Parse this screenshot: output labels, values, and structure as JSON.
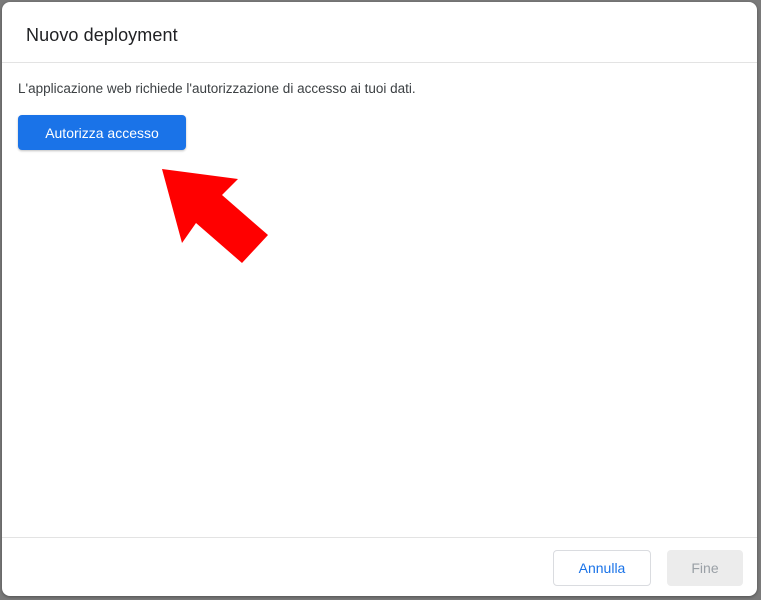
{
  "dialog": {
    "title": "Nuovo deployment",
    "message": "L'applicazione web richiede l'autorizzazione di accesso ai tuoi dati.",
    "authorize_label": "Autorizza accesso",
    "cancel_label": "Annulla",
    "done_label": "Fine",
    "done_disabled": true
  },
  "annotation": {
    "icon": "red-arrow-icon",
    "color": "#ff0000"
  },
  "colors": {
    "primary": "#1a73e8",
    "disabled_bg": "#ececec",
    "disabled_text": "#9aa0a6"
  }
}
